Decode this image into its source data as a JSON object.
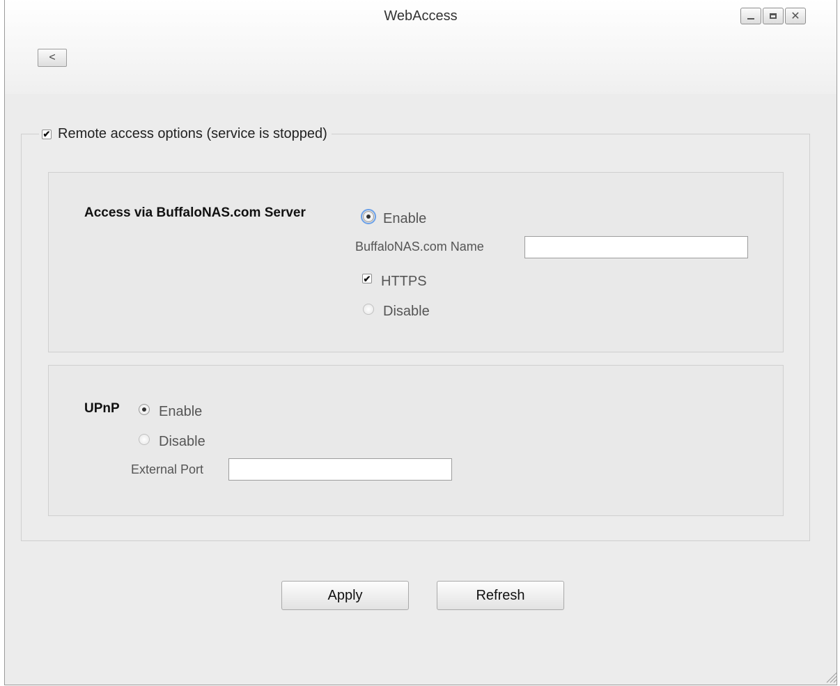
{
  "window": {
    "title": "WebAccess",
    "controls": {
      "minimize": "minimize-icon",
      "maximize": "maximize-icon",
      "close": "close-icon"
    },
    "back_label": "<"
  },
  "remote_access": {
    "label": "Remote access options (service is stopped)",
    "checked": true
  },
  "buffalonas": {
    "label": "Access via BuffaloNAS.com Server",
    "enable_label": "Enable",
    "enable_selected": true,
    "name_label": "BuffaloNAS.com Name",
    "name_value": "",
    "https_label": "HTTPS",
    "https_checked": true,
    "disable_label": "Disable"
  },
  "upnp": {
    "label": "UPnP",
    "enable_label": "Enable",
    "enable_selected": true,
    "disable_label": "Disable",
    "port_label": "External Port",
    "port_value": ""
  },
  "actions": {
    "apply_label": "Apply",
    "refresh_label": "Refresh"
  },
  "colors": {
    "background": "#ececec",
    "focus": "#6aa0e8"
  }
}
